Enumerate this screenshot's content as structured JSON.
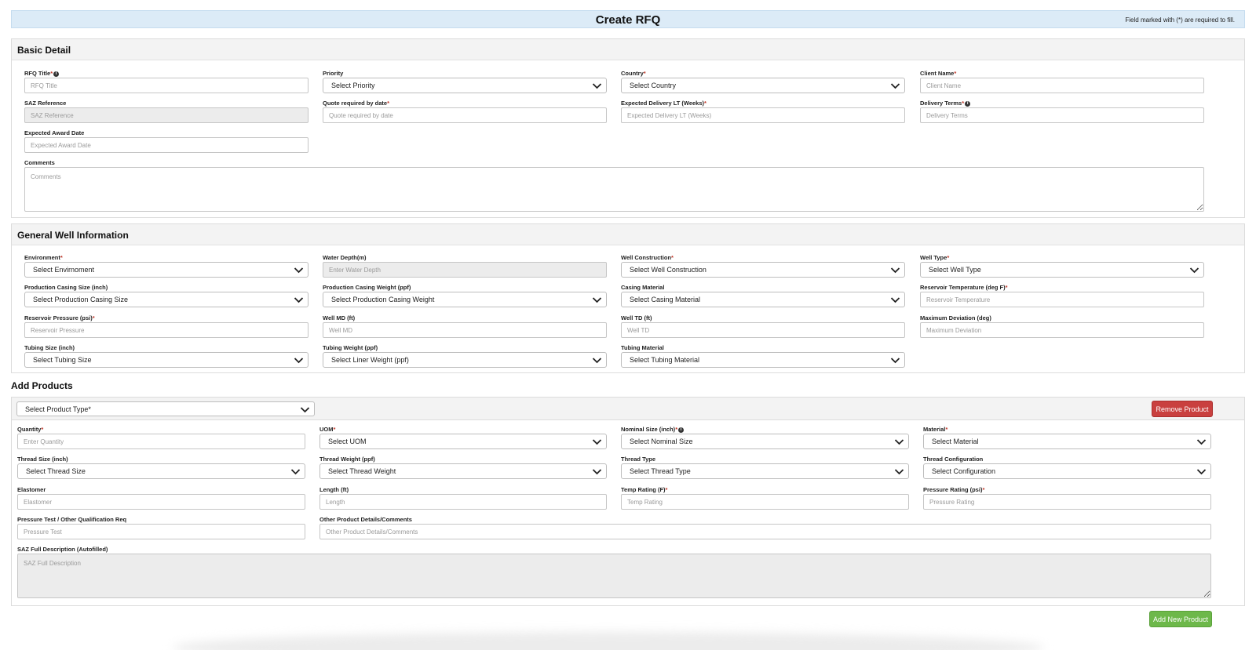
{
  "header": {
    "title": "Create RFQ",
    "note": "Field marked with (*) are required to fill."
  },
  "basic": {
    "heading": "Basic Detail",
    "rfq_title": {
      "label": "RFQ Title",
      "placeholder": "RFQ Title"
    },
    "priority": {
      "label": "Priority",
      "value": "Select Priority"
    },
    "country": {
      "label": "Country",
      "value": "Select Country"
    },
    "client_name": {
      "label": "Client Name",
      "placeholder": "Client Name"
    },
    "saz_reference": {
      "label": "SAZ Reference",
      "placeholder": "SAZ Reference"
    },
    "quote_date": {
      "label": "Quote required by date",
      "placeholder": "Quote required by date"
    },
    "delivery_lt": {
      "label": "Expected Delivery LT (Weeks)",
      "placeholder": "Expected Delivery LT (Weeks)"
    },
    "delivery_terms": {
      "label": "Delivery Terms",
      "placeholder": "Delivery Terms"
    },
    "award_date": {
      "label": "Expected Award Date",
      "placeholder": "Expected Award Date"
    },
    "comments": {
      "label": "Comments",
      "placeholder": "Comments"
    }
  },
  "well": {
    "heading": "General Well Information",
    "environment": {
      "label": "Environment",
      "value": "Select Envirnoment"
    },
    "water_depth": {
      "label": "Water Depth(m)",
      "placeholder": "Enter Water Depth"
    },
    "well_construction": {
      "label": "Well Construction",
      "value": "Select Well Construction"
    },
    "well_type": {
      "label": "Well Type",
      "value": "Select Well Type"
    },
    "casing_size": {
      "label": "Production Casing Size (inch)",
      "value": "Select Production Casing Size"
    },
    "casing_weight": {
      "label": "Production Casing Weight (ppf)",
      "value": "Select Production Casing Weight"
    },
    "casing_material": {
      "label": "Casing Material",
      "value": "Select Casing Material"
    },
    "reservoir_temp": {
      "label": "Reservoir Temperature (deg F)",
      "placeholder": "Reservoir Temperature"
    },
    "reservoir_pressure": {
      "label": "Reservoir Pressure (psi)",
      "placeholder": "Reservoir Pressure"
    },
    "well_md": {
      "label": "Well MD (ft)",
      "placeholder": "Well MD"
    },
    "well_td": {
      "label": "Well TD (ft)",
      "placeholder": "Well TD"
    },
    "max_deviation": {
      "label": "Maximum Deviation (deg)",
      "placeholder": "Maximum Deviation"
    },
    "tubing_size": {
      "label": "Tubing Size (inch)",
      "value": "Select Tubing Size"
    },
    "tubing_weight": {
      "label": "Tubing Weight (ppf)",
      "value": "Select Liner Weight (ppf)"
    },
    "tubing_material": {
      "label": "Tubing Material",
      "value": "Select Tubing Material"
    }
  },
  "products": {
    "heading": "Add Products",
    "product_type": {
      "value": "Select Product Type*"
    },
    "remove_label": "Remove Product",
    "add_label": "Add New Product",
    "quantity": {
      "label": "Quantity",
      "placeholder": "Enter Quantity"
    },
    "uom": {
      "label": "UOM",
      "value": "Select UOM"
    },
    "nominal_size": {
      "label": "Nominal Size (inch)",
      "value": "Select Nominal Size"
    },
    "material": {
      "label": "Material",
      "value": "Select Material"
    },
    "thread_size": {
      "label": "Thread Size (inch)",
      "value": "Select Thread Size"
    },
    "thread_weight": {
      "label": "Thread Weight (ppf)",
      "value": "Select Thread Weight"
    },
    "thread_type": {
      "label": "Thread Type",
      "value": "Select Thread Type"
    },
    "thread_config": {
      "label": "Thread Configuration",
      "value": "Select Configuration"
    },
    "elastomer": {
      "label": "Elastomer",
      "placeholder": "Elastomer"
    },
    "length": {
      "label": "Length (ft)",
      "placeholder": "Length"
    },
    "temp_rating": {
      "label": "Temp Rating (F)",
      "placeholder": "Temp Rating"
    },
    "pressure_rating": {
      "label": "Pressure Rating (psi)",
      "placeholder": "Pressure Rating"
    },
    "pressure_test": {
      "label": "Pressure Test / Other Qualification Req",
      "placeholder": "Pressure Test"
    },
    "other_details": {
      "label": "Other Product Details/Comments",
      "placeholder": "Other Product Details/Comments"
    },
    "saz_description": {
      "label": "SAZ Full Description (Autofilled)",
      "placeholder": "SAZ Full Description"
    }
  },
  "symbols": {
    "required": "*",
    "info": "i"
  }
}
